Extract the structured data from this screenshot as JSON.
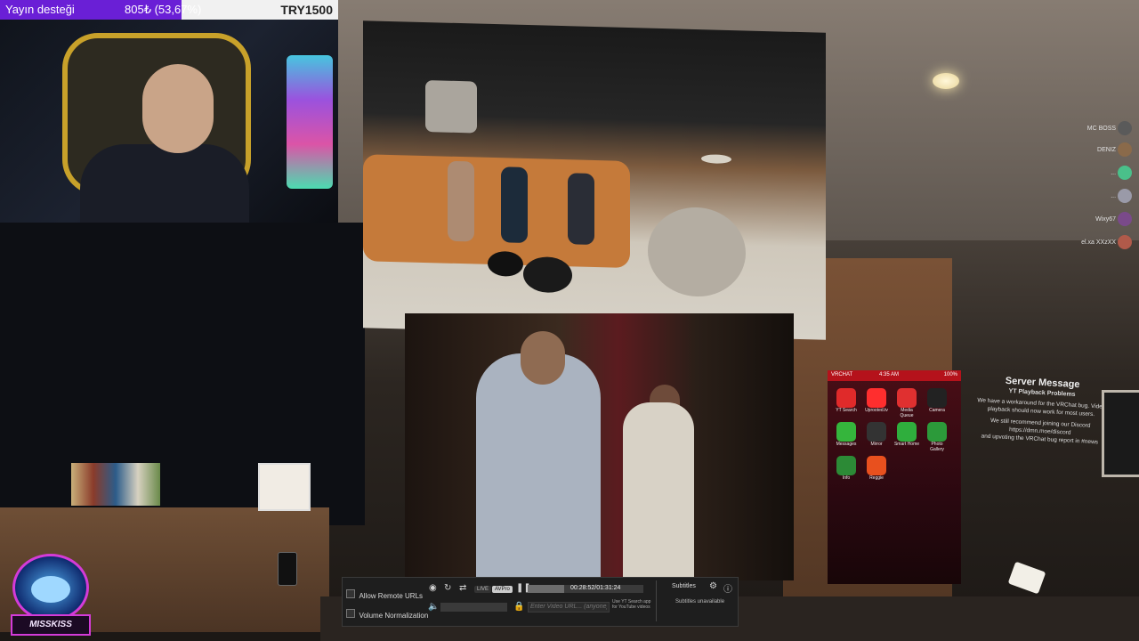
{
  "donation": {
    "label": "Yayın desteği",
    "amount": "805₺ (53,67%)",
    "progress": 0.5367,
    "goal": "TRY1500",
    "fill_color": "#6a1fd6"
  },
  "controls": {
    "allow_remote_urls": "Allow Remote URLs",
    "volume_normalization": "Volume Normalization",
    "mode_off": "LIVE",
    "mode_avpro": "AVPro",
    "time": "00:28:52/01:31:24",
    "progress": 0.316,
    "url_placeholder": "Enter Video URL... (anyone)",
    "hint": "Use YT Search app for YouTube videos",
    "subtitles": "Subtitles",
    "subtitles_unavailable": "Subtitles unavailable"
  },
  "apps": {
    "header_left": "VRCHAT",
    "header_time": "4:35 AM",
    "header_right": "100%",
    "items": [
      {
        "label": "YT Search",
        "color": "#e02a2a"
      },
      {
        "label": "Uprooted.tv",
        "color": "#ff2e2e"
      },
      {
        "label": "Media Queue",
        "color": "#e03030"
      },
      {
        "label": "Camera",
        "color": "#222222"
      },
      {
        "label": "Messages",
        "color": "#35b53c"
      },
      {
        "label": "Mirror",
        "color": "#333333"
      },
      {
        "label": "Smart Home",
        "color": "#2fae3d"
      },
      {
        "label": "Photo Gallery",
        "color": "#2c9a3a"
      },
      {
        "label": "Info",
        "color": "#2c8a36"
      },
      {
        "label": "Reggie",
        "color": "#e8501e"
      }
    ]
  },
  "server_message": {
    "title": "Server Message",
    "subtitle": "YT Playback Problems",
    "lines": [
      "We have a workaround for the VRChat bug. Video",
      "playback should now work for most users.",
      "We still recommend joining our Discord",
      "https://dmn.moe/discord",
      "and upvoting the VRChat bug report in #news"
    ]
  },
  "nameplates": [
    "MC BOSS",
    "DENIZ",
    "...",
    "...",
    "Wixy67",
    "el.xa XXzXX"
  ],
  "logo_text": "MISSKISS"
}
